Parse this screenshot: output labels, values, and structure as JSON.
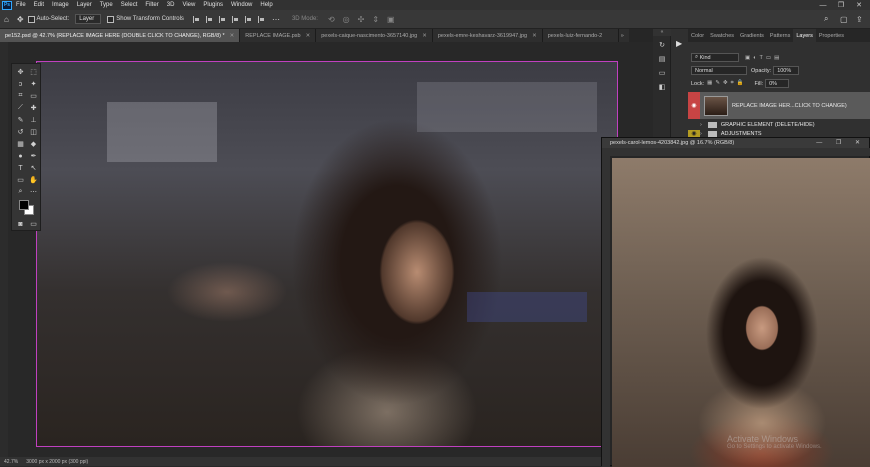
{
  "app": {
    "logo": "Ps"
  },
  "menu": [
    "File",
    "Edit",
    "Image",
    "Layer",
    "Type",
    "Select",
    "Filter",
    "3D",
    "View",
    "Plugins",
    "Window",
    "Help"
  ],
  "window_controls": {
    "minimize": "—",
    "restore": "❐",
    "close": "✕"
  },
  "options_bar": {
    "auto_select_label": "Auto-Select:",
    "auto_select_value": "Layer",
    "transform_controls_label": "Show Transform Controls",
    "mode_3d_label": "3D Mode:"
  },
  "doc_tabs": [
    {
      "label": "pe152.psd @ 42.7% (REPLACE IMAGE HERE (DOUBLE CLICK TO CHANGE), RGB/8) *",
      "active": true
    },
    {
      "label": "REPLACE IMAGE.psb",
      "active": false
    },
    {
      "label": "pexels-caique-nascimento-3657140.jpg",
      "active": false
    },
    {
      "label": "pexels-emre-keshavarz-3619947.jpg",
      "active": false
    },
    {
      "label": "pexels-luiz-fernando-2",
      "active": false
    }
  ],
  "tab_overflow": "»",
  "status_bar": {
    "left": "42.7%",
    "doc_size": "3000 px x 2000 px (300 ppi)"
  },
  "floating_window": {
    "title": "pexels-carol-lemos-4203842.jpg @ 16.7% (RGB/8)",
    "buttons": "— ❐ ✕"
  },
  "watermark": {
    "title": "Activate Windows",
    "subtitle": "Go to Settings to activate Windows."
  },
  "panel": {
    "tabs": [
      "Color",
      "Swatches",
      "Gradients",
      "Patterns",
      "Layers",
      "Properties"
    ],
    "active_tab": "Layers",
    "kind_label": "Kind",
    "blend_mode": "Normal",
    "opacity_label": "Opacity:",
    "opacity_value": "100%",
    "lock_label": "Lock:",
    "fill_label": "Fill:",
    "fill_value": "0%",
    "layers": [
      {
        "name": "REPLACE IMAGE HER...CLICK TO CHANGE)",
        "selected": true,
        "eye_color": "#c74444"
      },
      {
        "name": "GRAPHIC ELEMENT (DELETE/HIDE)",
        "selected": false
      },
      {
        "name": "ADJUSTMENTS",
        "selected": false,
        "eye_color": "#b49c22"
      }
    ]
  },
  "icons": {
    "move": "✥",
    "marquee": "⬚",
    "lasso": "ↄ",
    "magic_wand": "✦",
    "crop": "⌗",
    "eyedropper": "⟋",
    "healing": "✚",
    "brush": "✎",
    "stamp": "⊥",
    "history_brush": "↺",
    "eraser": "◫",
    "gradient": "▦",
    "blur": "◆",
    "dodge": "●",
    "pen": "✒",
    "type": "T",
    "path_select": "↖",
    "rectangle": "▭",
    "hand": "✋",
    "zoom": "⌕",
    "more": "⋯",
    "play": "▶",
    "eye": "◉"
  }
}
